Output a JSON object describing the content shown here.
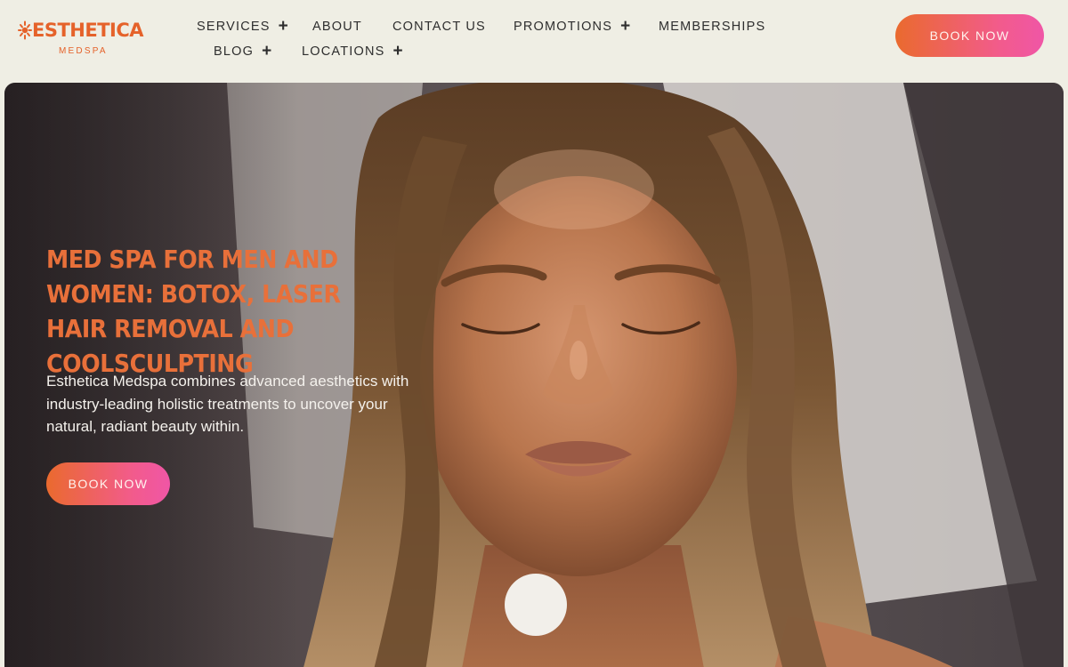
{
  "brand": {
    "name": "ESTHETICA",
    "tagline": "MEDSPA",
    "color": "#E5622A"
  },
  "nav": {
    "items": [
      {
        "label": "SERVICES",
        "has_submenu": true
      },
      {
        "label": "ABOUT",
        "has_submenu": false
      },
      {
        "label": "CONTACT US",
        "has_submenu": false
      },
      {
        "label": "PROMOTIONS",
        "has_submenu": true
      },
      {
        "label": "MEMBERSHIPS",
        "has_submenu": false
      },
      {
        "label": "BLOG",
        "has_submenu": true
      },
      {
        "label": "LOCATIONS",
        "has_submenu": true
      }
    ],
    "submenu_icon": "plus-icon"
  },
  "header": {
    "cta_label": "BOOK NOW"
  },
  "hero": {
    "heading": "MED SPA FOR MEN AND WOMEN: BOTOX, LASER HAIR REMOVAL AND COOLSCULPTING",
    "description": "Esthetica Medspa combines advanced aesthetics with industry-leading holistic treatments to uncover your natural, radiant beauty within.",
    "cta_label": "BOOK NOW",
    "image": "portrait-photo"
  },
  "colors": {
    "background": "#EFEEE4",
    "accent_orange": "#E8703A",
    "gradient_start": "#EA6A2E",
    "gradient_end": "#F056A6",
    "nav_text": "#2E2E2E"
  }
}
